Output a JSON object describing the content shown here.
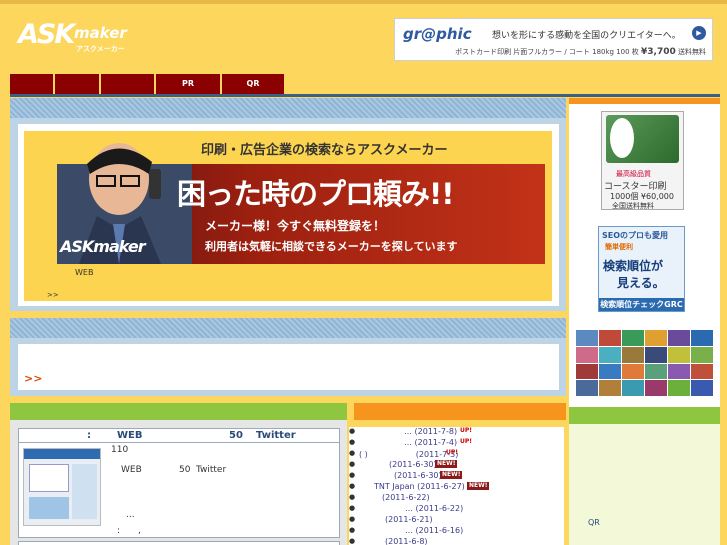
{
  "header": {
    "logo_main": "ASK",
    "logo_sub": "maker",
    "logo_kana": "アスクメーカー"
  },
  "ad": {
    "brand": "gr@phic",
    "copy": "想いを形にする感動を全国のクリエイターへ。",
    "detail": "ポストカード印刷 片面フルカラー / コート 180kg 100 枚",
    "price": "¥3,700",
    "shipping": "送料無料"
  },
  "nav": {
    "items": [
      "",
      "",
      "",
      "PR",
      "QR"
    ]
  },
  "banner": {
    "slogan": "印刷・広告企業の検索ならアスクメーカー",
    "headline": "困った時のプロ頼み!!",
    "sub1": "メーカー様！今すぐ無料登録を！",
    "sub2": "利用者は気軽に相談できるメーカーを探しています",
    "logo": "ASKmaker",
    "web_label": "WEB",
    "more": ">>"
  },
  "notice": {
    "more": ">>"
  },
  "feature": {
    "header_colon": ":",
    "header_web": "WEB",
    "header_num": "50",
    "header_twitter": "Twitter",
    "count": "110",
    "line_web": "WEB",
    "line_num": "50",
    "line_twitter": "Twitter",
    "dots": "...",
    "colon_line": ":　　,"
  },
  "news": {
    "items": [
      {
        "text": "… (2011-7-8)",
        "badge": "UP!",
        "badge_type": "up"
      },
      {
        "text": "… (2011-7-4)",
        "badge": "UP!",
        "badge_type": "up"
      },
      {
        "text": "( )　　　　　　(2011-7-3)",
        "badge": "UP!",
        "badge_type": "up"
      },
      {
        "text": "(2011-6-30)",
        "badge": "NEW!",
        "badge_type": "new"
      },
      {
        "text": "(2011-6-30)",
        "badge": "NEW!",
        "badge_type": "new"
      },
      {
        "text": "TNT Japan (2011-6-27)",
        "badge": "NEW!",
        "badge_type": "new"
      },
      {
        "text": "(2011-6-22)",
        "badge": "",
        "badge_type": ""
      },
      {
        "text": "… (2011-6-22)",
        "badge": "",
        "badge_type": ""
      },
      {
        "text": "(2011-6-21)",
        "badge": "",
        "badge_type": ""
      },
      {
        "text": "… (2011-6-16)",
        "badge": "",
        "badge_type": ""
      },
      {
        "text": "(2011-6-8)",
        "badge": "",
        "badge_type": ""
      }
    ]
  },
  "sidebar": {
    "coaster_tag": "最高級品質",
    "coaster_title": "コースター印刷",
    "coaster_price": "1000個 ¥60,000",
    "coaster_ship": "全国送料無料",
    "seo_title": "SEOのプロも愛用",
    "seo_badge": "簡単便利",
    "seo_line1": "検索順位が",
    "seo_line2": "見える。",
    "seo_footer": "検索順位チェックGRC",
    "qr": "QR"
  },
  "colors": {
    "background": "#fdd65e",
    "nav": "#8b0000",
    "green": "#8ec63f",
    "orange": "#f7941d",
    "link": "#2a4a7a"
  }
}
